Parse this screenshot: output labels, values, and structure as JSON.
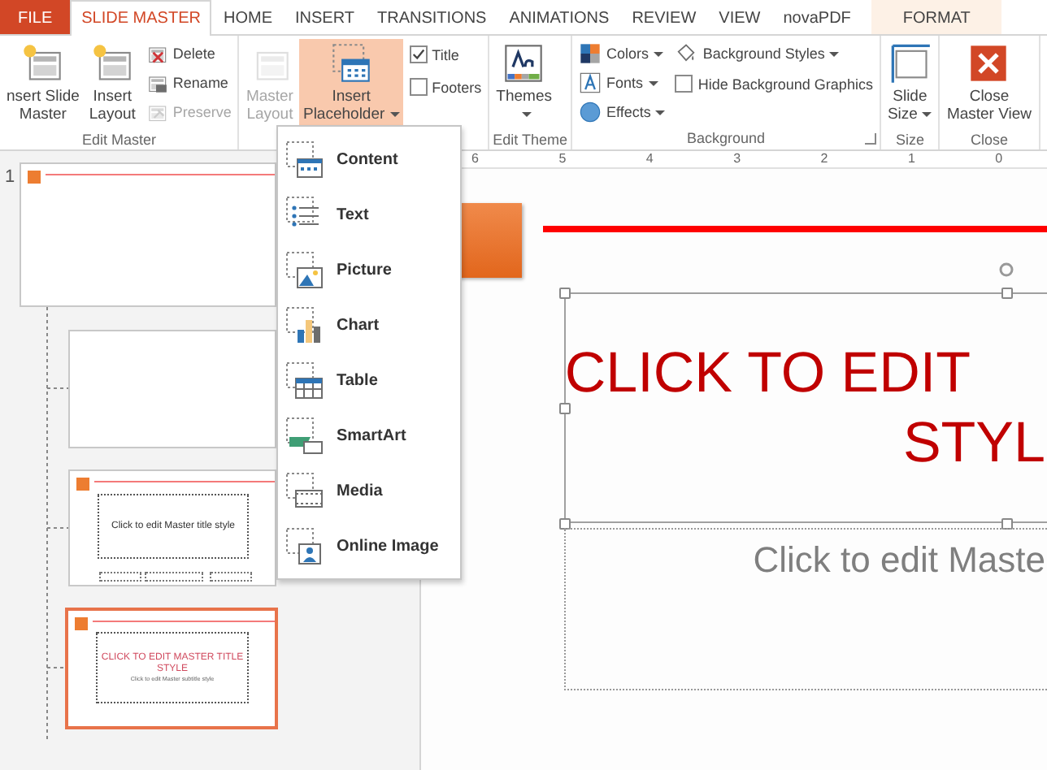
{
  "tabs": [
    {
      "label": "FILE",
      "kind": "file",
      "selected": false
    },
    {
      "label": "SLIDE MASTER",
      "kind": "tab",
      "selected": true
    },
    {
      "label": "HOME",
      "kind": "tab",
      "selected": false
    },
    {
      "label": "INSERT",
      "kind": "tab",
      "selected": false
    },
    {
      "label": "TRANSITIONS",
      "kind": "tab",
      "selected": false
    },
    {
      "label": "ANIMATIONS",
      "kind": "tab",
      "selected": false
    },
    {
      "label": "REVIEW",
      "kind": "tab",
      "selected": false
    },
    {
      "label": "VIEW",
      "kind": "tab",
      "selected": false
    },
    {
      "label": "novaPDF",
      "kind": "tab",
      "selected": false
    },
    {
      "label": "FORMAT",
      "kind": "contextual",
      "selected": false
    }
  ],
  "ribbon": {
    "groups": [
      {
        "label": "Edit Master",
        "dialog_launcher": false,
        "columns": [
          [
            {
              "label": "nsert Slide\nMaster",
              "kind": "slidemaster",
              "disabled": false,
              "dropdown": false,
              "expanded": false
            }
          ],
          [
            {
              "label": "Insert\nLayout",
              "kind": "layout",
              "disabled": false,
              "dropdown": false,
              "expanded": false
            }
          ],
          [
            {
              "label": "Delete",
              "kind": "delete",
              "disabled": false,
              "dropdown": false,
              "expanded": false
            },
            {
              "label": "Rename",
              "kind": "rename",
              "disabled": false,
              "dropdown": false,
              "expanded": false
            },
            {
              "label": "Preserve",
              "kind": "preserve",
              "disabled": true,
              "dropdown": false,
              "expanded": false
            }
          ]
        ]
      },
      {
        "dialog_launcher": false,
        "columns": [
          [
            {
              "label": "Master\nLayout",
              "kind": "masterlayout",
              "disabled": true,
              "dropdown": false,
              "expanded": false
            }
          ],
          [
            {
              "label": "Insert\nPlaceholder",
              "kind": "placeholder",
              "disabled": false,
              "dropdown": true,
              "expanded": true
            }
          ],
          [
            {
              "label": "Title",
              "kind": "check",
              "checked": true
            },
            {
              "label": "Footers",
              "kind": "check",
              "checked": false
            }
          ]
        ]
      },
      {
        "label": "Edit Theme",
        "dialog_launcher": false,
        "columns": [
          [
            {
              "label": "Themes\n",
              "kind": "themes",
              "disabled": false,
              "dropdown": true,
              "expanded": false
            }
          ]
        ]
      },
      {
        "label": "Background",
        "dialog_launcher": true,
        "columns": [
          [
            {
              "label": "Colors",
              "kind": "colors",
              "disabled": false,
              "dropdown": true,
              "expanded": false
            },
            {
              "label": "Fonts",
              "kind": "fonts",
              "disabled": false,
              "dropdown": true,
              "expanded": false
            },
            {
              "label": "Effects",
              "kind": "effects",
              "disabled": false,
              "dropdown": true,
              "expanded": false
            }
          ],
          [
            {
              "label": "Background Styles",
              "kind": "bgstyles",
              "disabled": false,
              "dropdown": true,
              "expanded": false
            },
            {
              "label": "Hide Background Graphics",
              "kind": "check",
              "checked": false
            }
          ]
        ]
      },
      {
        "label": "Size",
        "dialog_launcher": false,
        "columns": [
          [
            {
              "label": "Slide\nSize",
              "kind": "slidesize",
              "disabled": false,
              "dropdown": true,
              "expanded": false
            }
          ]
        ]
      },
      {
        "label": "Close",
        "dialog_launcher": false,
        "columns": [
          [
            {
              "label": "Close\nMaster View",
              "kind": "close",
              "disabled": false,
              "dropdown": false,
              "expanded": false
            }
          ]
        ]
      }
    ]
  },
  "placeholder_menu": [
    {
      "label": "Content",
      "kind": "content"
    },
    {
      "label": "Text",
      "kind": "text"
    },
    {
      "label": "Picture",
      "kind": "picture"
    },
    {
      "label": "Chart",
      "kind": "chart"
    },
    {
      "label": "Table",
      "kind": "table"
    },
    {
      "label": "SmartArt",
      "kind": "smartart"
    },
    {
      "label": "Media",
      "kind": "media"
    },
    {
      "label": "Online Image",
      "kind": "onlineimage"
    }
  ],
  "ruler": {
    "labels": [
      "6",
      "5",
      "4",
      "3",
      "2",
      "1",
      "0"
    ]
  },
  "thumbnails": [
    {
      "kind": "master",
      "number": "1",
      "selected": false
    },
    {
      "kind": "blank",
      "selected": false
    },
    {
      "kind": "layout",
      "title": "Click to edit Master title style",
      "selected": false
    },
    {
      "kind": "title",
      "title": "CLICK TO EDIT MASTER TITLE STYLE",
      "subtitle": "Click to edit Master subtitle style",
      "selected": true
    }
  ],
  "slide": {
    "title_lines": [
      "CLICK TO EDIT",
      "STYL"
    ],
    "subtitle": "Click to edit Maste"
  }
}
